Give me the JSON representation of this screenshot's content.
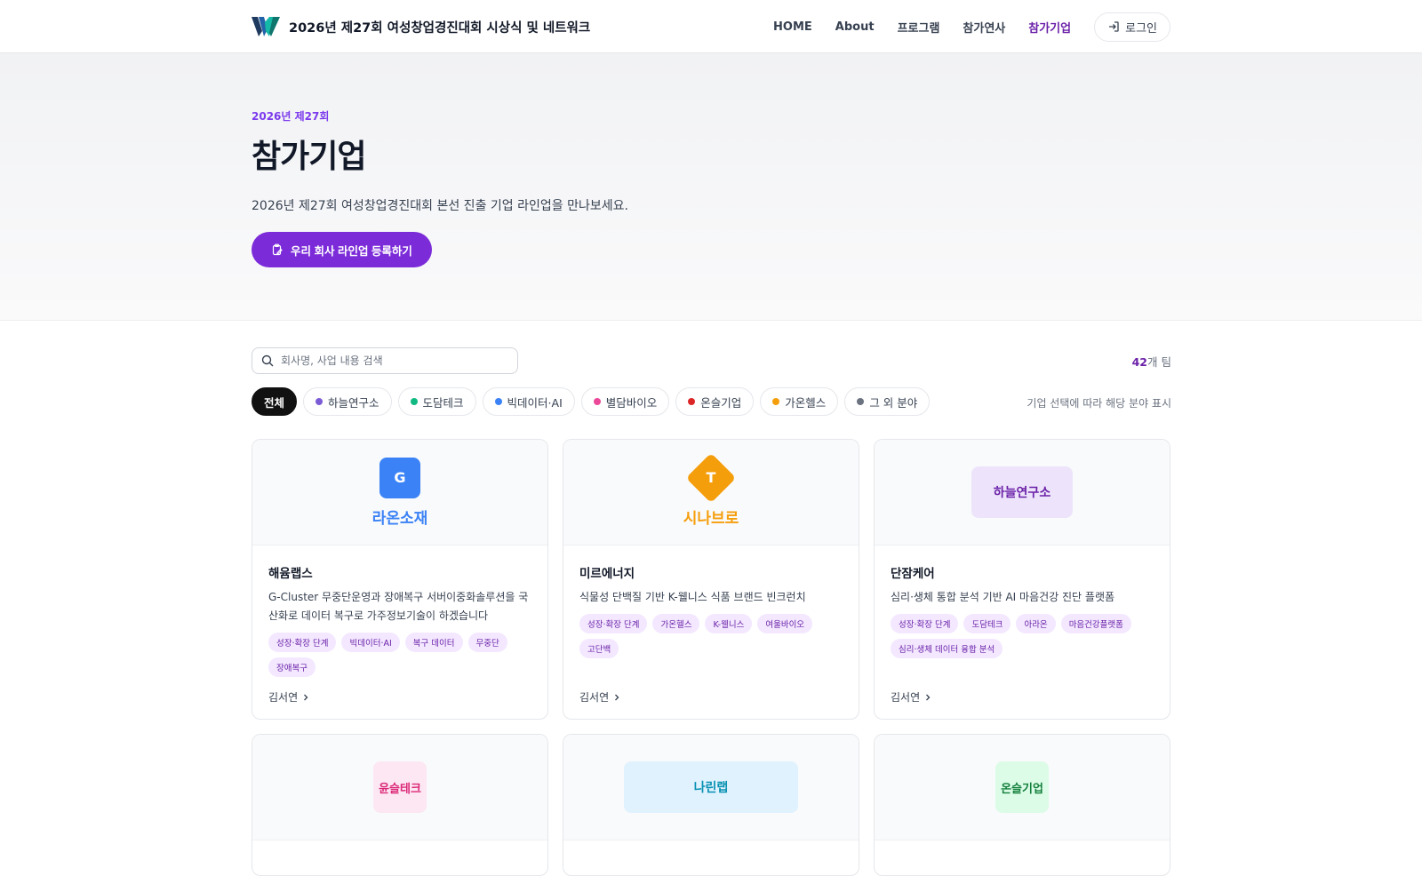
{
  "header": {
    "site_title": "2026년 제27회 여성창업경진대회 시상식 및 네트워크",
    "nav": [
      "HOME",
      "About",
      "프로그램",
      "참가연사",
      "참가기업"
    ],
    "login": "로그인"
  },
  "hero": {
    "eyebrow": "2026년 제27회",
    "title": "참가기업",
    "description": "2026년 제27회 여성창업경진대회 본선 진출 기업 라인업을 만나보세요.",
    "cta": "우리 회사 라인업 등록하기"
  },
  "toolbar": {
    "search_placeholder": "회사명, 사업 내용 검색",
    "count_number": "42",
    "count_suffix": "개 팀"
  },
  "filters": {
    "chips": [
      {
        "label": "전체",
        "color": ""
      },
      {
        "label": "하늘연구소",
        "color": "#7c5cd6"
      },
      {
        "label": "도담테크",
        "color": "#10b981"
      },
      {
        "label": "빅데이터·AI",
        "color": "#3b82f6"
      },
      {
        "label": "별담바이오",
        "color": "#ec4899"
      },
      {
        "label": "온슬기업",
        "color": "#dc2626"
      },
      {
        "label": "가온헬스",
        "color": "#f59e0b"
      },
      {
        "label": "그 외 분야",
        "color": "#6b7280"
      }
    ],
    "note": "기업 선택에 따라 해당 분야 표시"
  },
  "cards": [
    {
      "logo_letter": "G",
      "logo_text": "라온소재",
      "company": "해윰랩스",
      "description": "G-Cluster 무중단운영과 장애복구 서버이중화솔루션을 국산화로 데이터 복구로 가주정보기술이 하겠습니다",
      "tags": [
        "성장·확장 단계",
        "빅데이터·AI",
        "복구 데이터",
        "무중단",
        "장애복구"
      ],
      "person": "김서연"
    },
    {
      "logo_letter": "T",
      "logo_text": "시나브로",
      "company": "미르에너지",
      "description": "식물성 단백질 기반 K-웰니스 식품 브랜드 빈크런치",
      "tags": [
        "성장·확장 단계",
        "가온헬스",
        "K-웰니스",
        "여울바이오",
        "고단백"
      ],
      "person": "김서연"
    },
    {
      "logo_text": "하늘연구소",
      "company": "단잠케어",
      "description": "심리·생체 통합 분석 기반 AI 마음건강 진단 플랫폼",
      "tags": [
        "성장·확장 단계",
        "도담테크",
        "아라온",
        "마음건강플랫폼",
        "심리·생체 데이터 융합 분석"
      ],
      "person": "김서연"
    },
    {
      "logo_text": "윤슬테크"
    },
    {
      "logo_text": "나린랩"
    },
    {
      "logo_text": "온슬기업"
    }
  ],
  "colors": {
    "accent": "#7c2bd9",
    "active_nav": "#6b21a8",
    "tag_bg": "#f3e8ff",
    "raon_blue": "#3b82f6",
    "sinabro_orange": "#f59e0b"
  }
}
